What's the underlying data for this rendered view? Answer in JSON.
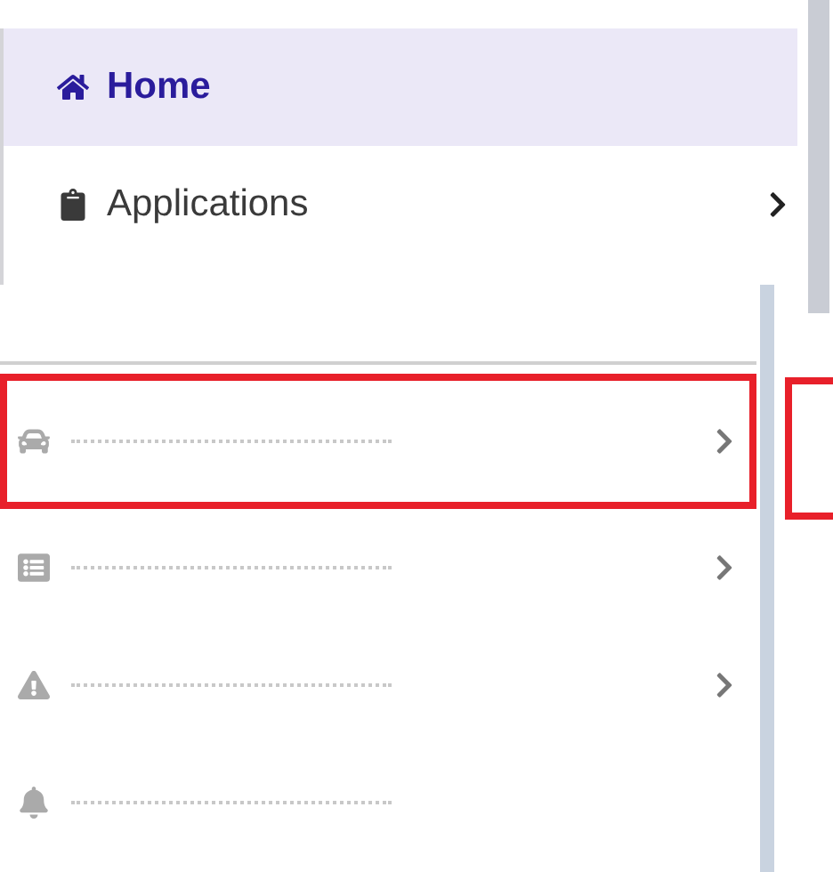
{
  "top_menu": [
    {
      "label": "Home",
      "selected": true,
      "has_submenu": false,
      "kind": "home"
    },
    {
      "label": "Applications",
      "selected": false,
      "has_submenu": true,
      "kind": "clipboard"
    }
  ],
  "lower_menu": [
    {
      "kind": "car",
      "highlighted": true,
      "has_submenu": true
    },
    {
      "kind": "list",
      "highlighted": false,
      "has_submenu": true
    },
    {
      "kind": "warning",
      "highlighted": false,
      "has_submenu": true
    },
    {
      "kind": "bell",
      "highlighted": false,
      "has_submenu": false
    }
  ]
}
